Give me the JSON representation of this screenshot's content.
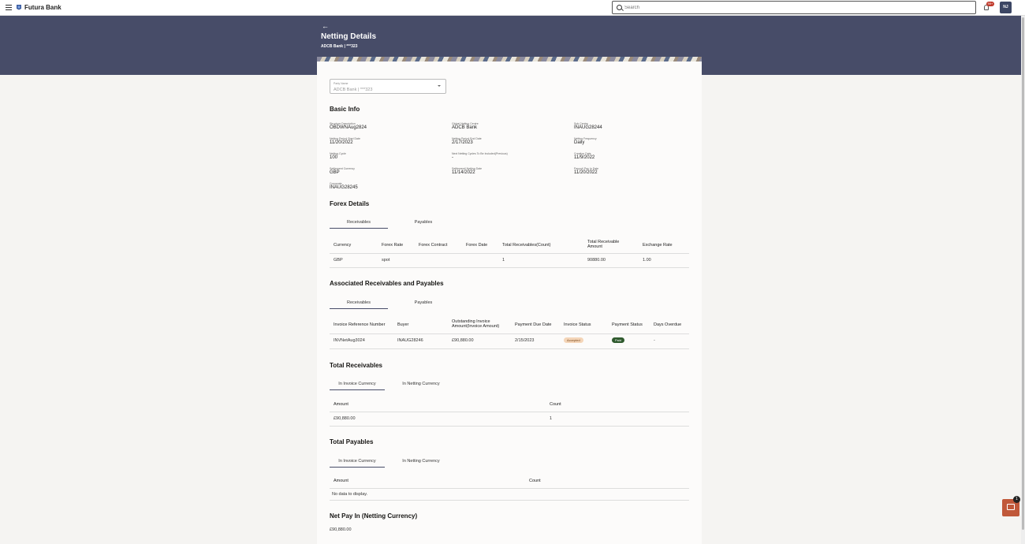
{
  "app": {
    "brand": "Futura Bank"
  },
  "search": {
    "placeholder": "Search"
  },
  "notifications": {
    "badge": "99+"
  },
  "user": {
    "initials": "NJ"
  },
  "header": {
    "back": "←",
    "title": "Netting Details",
    "subtitle": "ADCB Bank | ***323"
  },
  "party": {
    "label": "Party Name",
    "value": "ADCB Bank | ***323"
  },
  "basic_info": {
    "title": "Basic Info",
    "fields": [
      {
        "label": "Structure Description",
        "value": "OBDWNAug2824"
      },
      {
        "label": "Global Netting Centre",
        "value": "ADCB Bank"
      },
      {
        "label": "Sub Centre",
        "value": "INAUG28244"
      },
      {
        "label": "Netting Period Start Date",
        "value": "11/20/2022"
      },
      {
        "label": "Netting Period End Date",
        "value": "2/17/2023"
      },
      {
        "label": "Netting Frequency",
        "value": "Daily"
      },
      {
        "label": "Netting Cycle",
        "value": "100"
      },
      {
        "label": "Next Netting Cycles To Be Included(Previous)",
        "value": "-"
      },
      {
        "label": "Creation Date",
        "value": "11/9/2022"
      },
      {
        "label": "Settlement Currency",
        "value": "GBP"
      },
      {
        "label": "Settlement/ Netting Date",
        "value": "11/14/2022"
      },
      {
        "label": "Payout/ Pay In Date",
        "value": "11/20/2022"
      },
      {
        "label": "Corporate",
        "value": "INAUG28245"
      }
    ]
  },
  "forex": {
    "title": "Forex Details",
    "tabs": [
      "Receivables",
      "Payables"
    ],
    "columns": [
      "Currency",
      "Forex Rate",
      "Forex Contract",
      "Forex Date",
      "Total Receivables(Count)",
      "Total Receivable Amount",
      "Exchange Rate"
    ],
    "rows": [
      [
        "GBP",
        "spot",
        "",
        "",
        "1",
        "90880.00",
        "1.00"
      ]
    ]
  },
  "associated": {
    "title": "Associated Receivables and Payables",
    "tabs": [
      "Receivables",
      "Payables"
    ],
    "columns": [
      "Invoice Reference Number",
      "Buyer",
      "Outstanding Invoice Amount(Invoice Amount)",
      "Payment Due Date",
      "Invoice Status",
      "Payment Status",
      "Days Overdue"
    ],
    "rows": [
      {
        "ref": "INVNetAug3024",
        "buyer": "INAUG28246",
        "amount": "£90,880.00",
        "due": "2/15/2023",
        "invoice_status": "Accepted",
        "payment_status": "Paid",
        "overdue": "-"
      }
    ]
  },
  "total_receivables": {
    "title": "Total Receivables",
    "tabs": [
      "In Invoice Currency",
      "In Netting Currency"
    ],
    "columns": [
      "Amount",
      "Count"
    ],
    "rows": [
      [
        "£90,880.00",
        "1"
      ]
    ]
  },
  "total_payables": {
    "title": "Total Payables",
    "tabs": [
      "In Invoice Currency",
      "In Netting Currency"
    ],
    "columns": [
      "Amount",
      "Count"
    ],
    "empty": "No data to display."
  },
  "net_pay_in": {
    "title": "Net Pay In (Netting Currency)",
    "value": "£90,880.00"
  },
  "chat": {
    "badge": "1"
  },
  "colors": {
    "band": "#474c68",
    "accent": "#c0583a",
    "paid": "#2f5a2e",
    "accepted": "#f4d5b8"
  }
}
